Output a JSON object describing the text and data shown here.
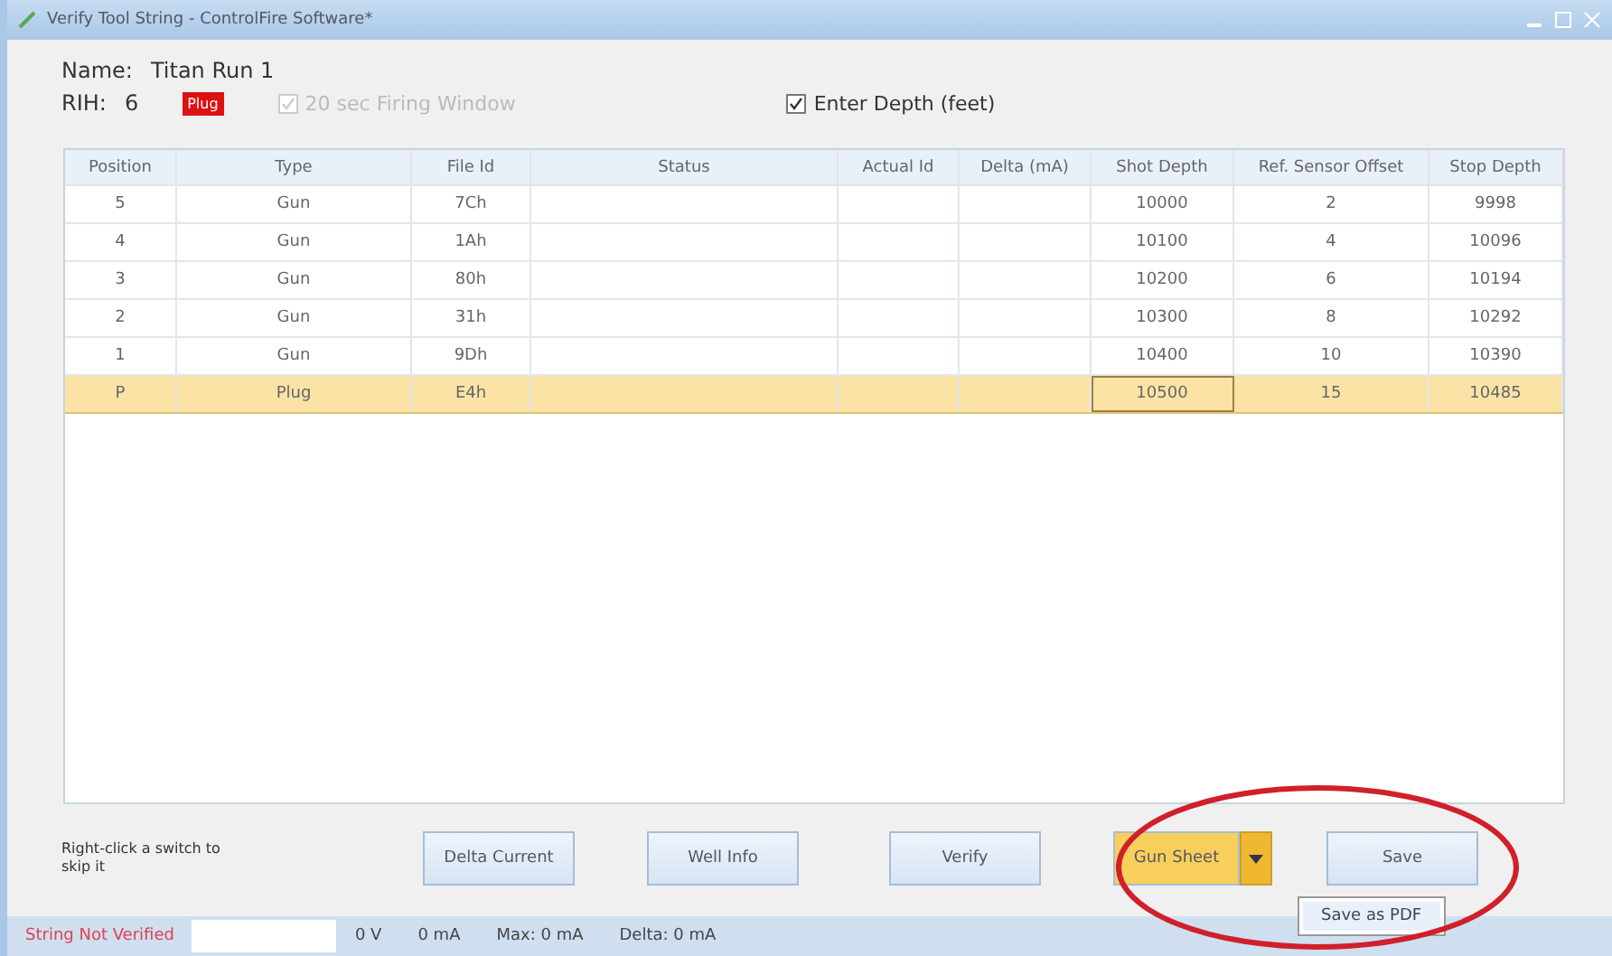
{
  "window": {
    "title": "Verify Tool String - ControlFire Software*"
  },
  "name": {
    "label": "Name:",
    "value": "Titan Run 1"
  },
  "rih": {
    "label": "RIH:",
    "value": "6",
    "badge": "Plug"
  },
  "options": [
    {
      "label": "20 sec Firing Window",
      "checked": true,
      "disabled": true
    },
    {
      "label": "Enter Depth (feet)",
      "checked": true,
      "disabled": false
    }
  ],
  "table": {
    "columns": [
      "Position",
      "Type",
      "File Id",
      "Status",
      "Actual Id",
      "Delta (mA)",
      "Shot Depth",
      "Ref. Sensor Offset",
      "Stop Depth"
    ],
    "rows": [
      {
        "cells": [
          "5",
          "Gun",
          "7Ch",
          "",
          "",
          "",
          "10000",
          "2",
          "9998"
        ],
        "selected": false
      },
      {
        "cells": [
          "4",
          "Gun",
          "1Ah",
          "",
          "",
          "",
          "10100",
          "4",
          "10096"
        ],
        "selected": false
      },
      {
        "cells": [
          "3",
          "Gun",
          "80h",
          "",
          "",
          "",
          "10200",
          "6",
          "10194"
        ],
        "selected": false
      },
      {
        "cells": [
          "2",
          "Gun",
          "31h",
          "",
          "",
          "",
          "10300",
          "8",
          "10292"
        ],
        "selected": false
      },
      {
        "cells": [
          "1",
          "Gun",
          "9Dh",
          "",
          "",
          "",
          "10400",
          "10",
          "10390"
        ],
        "selected": false
      },
      {
        "cells": [
          "P",
          "Plug",
          "E4h",
          "",
          "",
          "",
          "10500",
          "15",
          "10485"
        ],
        "selected": true
      }
    ]
  },
  "hint": "Right-click a switch to skip it",
  "buttons": [
    {
      "label": "Delta Current",
      "kind": "plain"
    },
    {
      "label": "Well Info",
      "kind": "plain"
    },
    {
      "label": "Verify",
      "kind": "plain"
    },
    {
      "label": "Gun Sheet",
      "kind": "split"
    },
    {
      "label": "Save",
      "kind": "plain"
    }
  ],
  "menu": [
    "Save as PDF"
  ],
  "status_bar": [
    "String Not Verified",
    "0 V",
    "0 mA",
    "Max: 0 mA",
    "Delta: 0 mA"
  ]
}
